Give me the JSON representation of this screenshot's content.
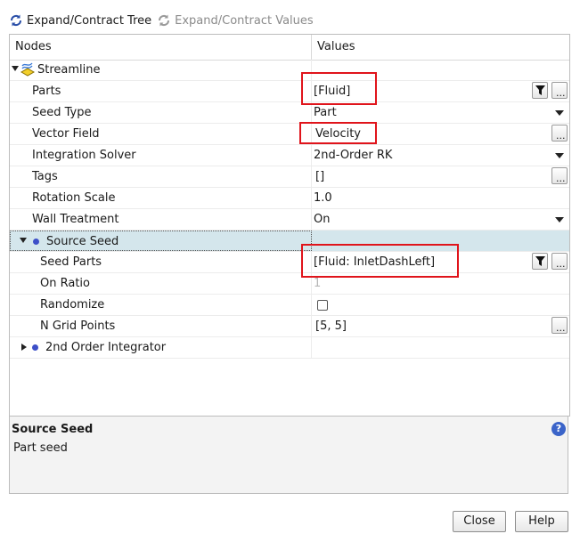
{
  "toolbar": {
    "expand_tree": "Expand/Contract Tree",
    "expand_values": "Expand/Contract Values"
  },
  "table": {
    "col_nodes": "Nodes",
    "col_values": "Values"
  },
  "rows": {
    "streamline": "Streamline",
    "parts": {
      "label": "Parts",
      "value": "[Fluid]"
    },
    "seed_type": {
      "label": "Seed Type",
      "value": "Part"
    },
    "vector_field": {
      "label": "Vector Field",
      "value": "Velocity"
    },
    "integration_solver": {
      "label": "Integration Solver",
      "value": "2nd-Order RK"
    },
    "tags": {
      "label": "Tags",
      "value": "[]"
    },
    "rotation_scale": {
      "label": "Rotation Scale",
      "value": "1.0"
    },
    "wall_treatment": {
      "label": "Wall Treatment",
      "value": "On"
    },
    "source_seed": {
      "label": "Source Seed"
    },
    "seed_parts": {
      "label": "Seed Parts",
      "value": "[Fluid: InletDashLeft]"
    },
    "on_ratio": {
      "label": "On Ratio",
      "value": "1"
    },
    "randomize": {
      "label": "Randomize",
      "checked": false
    },
    "n_grid_points": {
      "label": "N Grid Points",
      "value": "[5, 5]"
    },
    "second_order_integrator": {
      "label": "2nd Order Integrator"
    }
  },
  "buttons": {
    "ellipsis": "..."
  },
  "description": {
    "title": "Source Seed",
    "text": "Part seed",
    "help_icon": "?"
  },
  "dialog": {
    "close": "Close",
    "help": "Help"
  },
  "colors": {
    "highlight_box": "#e0141b",
    "selected_row": "#d4e6ec",
    "node_dot": "#3d4fc8"
  }
}
